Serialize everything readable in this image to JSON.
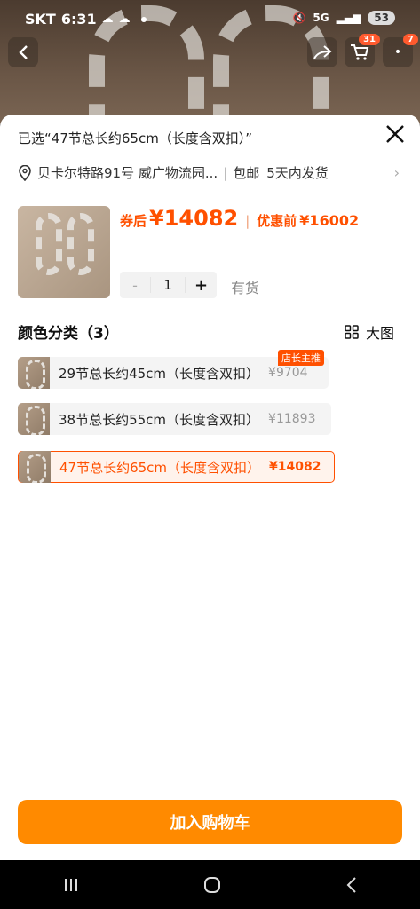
{
  "status": {
    "carrier": "SKT",
    "time": "6:31",
    "network": "5G",
    "battery": "53"
  },
  "nav": {
    "cart_badge": "31",
    "more_badge": "7"
  },
  "sheet": {
    "selected_title": "已选“47节总长约65cm（长度含双扣）”",
    "address": "贝卡尔特路91号 威广物流园...",
    "shipping": "包邮",
    "delivery": "5天内发货",
    "price_label": "券后",
    "price": "¥14082",
    "pre_label": "优惠前",
    "pre_price": "¥16002",
    "qty_minus": "-",
    "qty_value": "1",
    "qty_plus": "+",
    "stock": "有货",
    "category_title": "颜色分类（3）",
    "big_image_label": "大图",
    "hot_tag": "店长主推",
    "options": [
      {
        "name": "29节总长约45cm（长度含双扣）",
        "price": "¥9704"
      },
      {
        "name": "38节总长约55cm（长度含双扣）",
        "price": "¥11893"
      },
      {
        "name": "47节总长约65cm（长度含双扣）",
        "price": "¥14082"
      }
    ],
    "add_to_cart": "加入购物车"
  },
  "colors": {
    "accent": "#ff5000",
    "button": "#ff8a00"
  }
}
